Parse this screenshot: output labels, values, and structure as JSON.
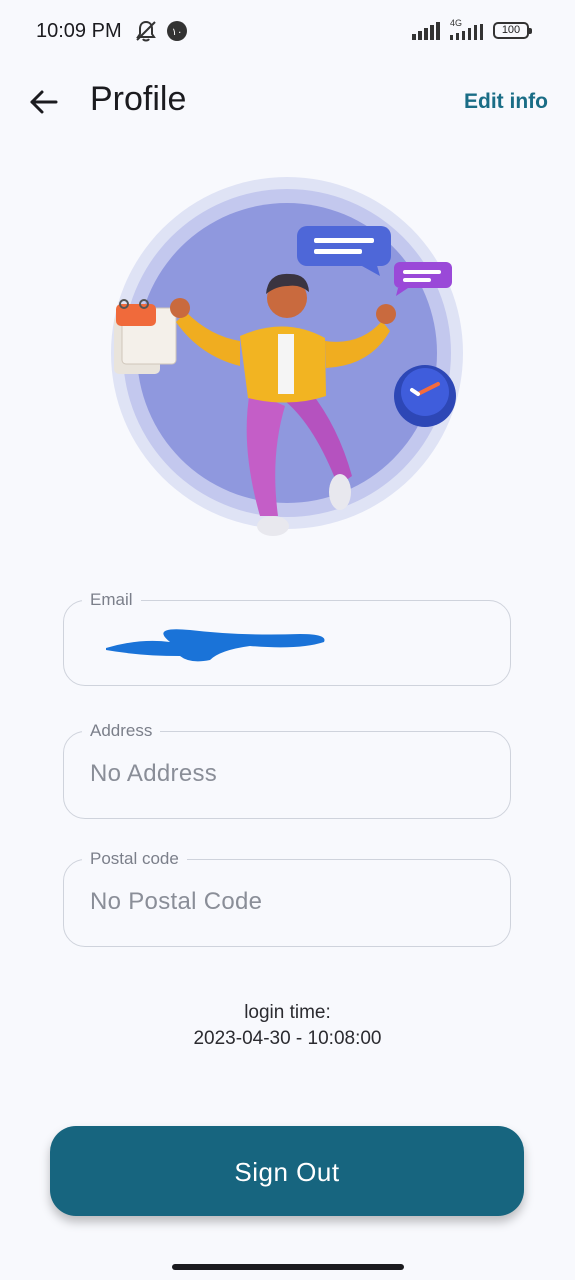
{
  "status_bar": {
    "time": "10:09 PM",
    "notification_count": "١٠",
    "network_type": "4G",
    "battery_level": "100",
    "icons": [
      "mute-icon",
      "notification-badge-icon",
      "signal-icon",
      "signal-4g-icon",
      "battery-icon"
    ]
  },
  "header": {
    "title": "Profile",
    "edit_label": "Edit info",
    "back_icon": "arrow-left-icon"
  },
  "form": {
    "email": {
      "label": "Email",
      "value": ""
    },
    "address": {
      "label": "Address",
      "value": "No Address"
    },
    "postal": {
      "label": "Postal code",
      "value": "No Postal Code"
    }
  },
  "login": {
    "label": "login time:",
    "time": "2023-04-30 - 10:08:00"
  },
  "actions": {
    "signout_label": "Sign Out"
  },
  "colors": {
    "accent": "#17657f",
    "background": "#f8f9fd",
    "hero_circle": "#8f98de"
  }
}
